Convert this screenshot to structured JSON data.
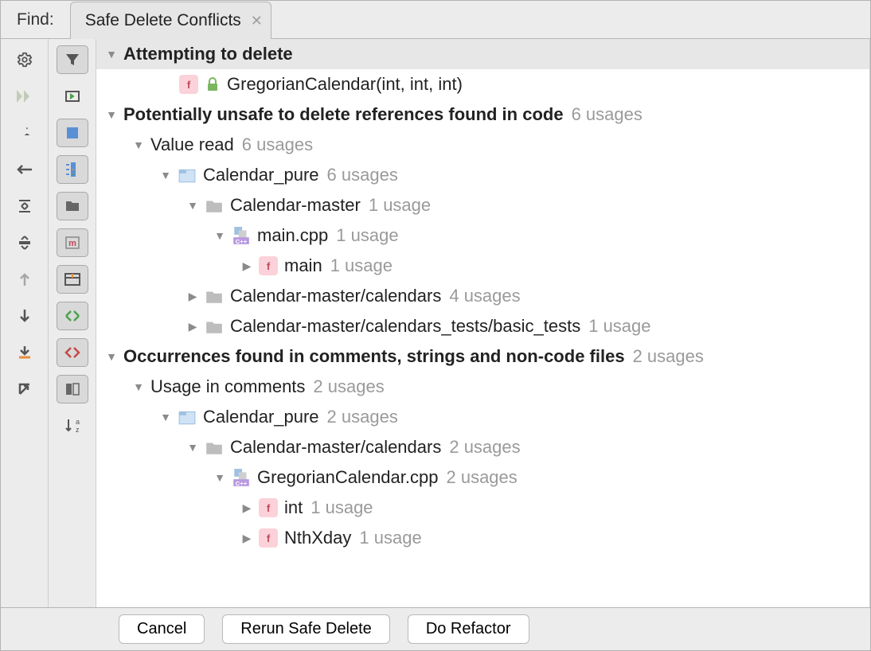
{
  "tabbar": {
    "find_label": "Find:",
    "tab_title": "Safe Delete Conflicts"
  },
  "tree": {
    "s1": {
      "title": "Attempting to delete"
    },
    "target": {
      "name": "GregorianCalendar(int, int, int)"
    },
    "s2": {
      "title": "Potentially unsafe to delete references found in code",
      "usages": "6 usages"
    },
    "vr": {
      "label": "Value read",
      "usages": "6 usages"
    },
    "cp1": {
      "label": "Calendar_pure",
      "usages": "6 usages"
    },
    "cm1": {
      "label": "Calendar-master",
      "usages": "1 usage"
    },
    "mcpp": {
      "label": "main.cpp",
      "usages": "1 usage"
    },
    "mainfn": {
      "label": "main",
      "usages": "1 usage"
    },
    "cmc": {
      "label": "Calendar-master/calendars",
      "usages": "4 usages"
    },
    "cmt": {
      "label": "Calendar-master/calendars_tests/basic_tests",
      "usages": "1 usage"
    },
    "s3": {
      "title": "Occurrences found in comments, strings and non-code files",
      "usages": "2 usages"
    },
    "uic": {
      "label": "Usage in comments",
      "usages": "2 usages"
    },
    "cp2": {
      "label": "Calendar_pure",
      "usages": "2 usages"
    },
    "cmc2": {
      "label": "Calendar-master/calendars",
      "usages": "2 usages"
    },
    "gcpp": {
      "label": "GregorianCalendar.cpp",
      "usages": "2 usages"
    },
    "intfn": {
      "label": "int",
      "usages": "1 usage"
    },
    "nth": {
      "label": "NthXday",
      "usages": "1 usage"
    }
  },
  "buttons": {
    "cancel": "Cancel",
    "rerun": "Rerun Safe Delete",
    "do": "Do Refactor"
  }
}
